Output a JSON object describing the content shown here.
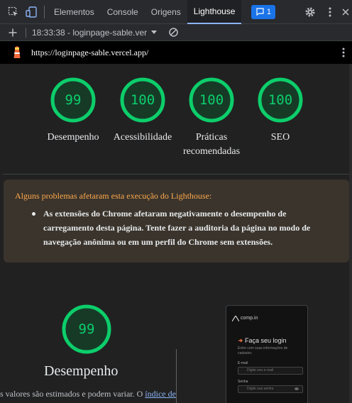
{
  "devtools": {
    "tabs": [
      "Elementos",
      "Console",
      "Origens",
      "Lighthouse"
    ],
    "active_tab": "Lighthouse",
    "issues_count": "1",
    "toolbar": {
      "report_select": "18:33:38 - loginpage-sable.ver"
    }
  },
  "url_bar": {
    "url": "https://loginpage-sable.vercel.app/"
  },
  "summary": {
    "scores": [
      {
        "value": "99",
        "label": "Desempenho"
      },
      {
        "value": "100",
        "label": "Acessibilidade"
      },
      {
        "value": "100",
        "label": "Práticas recomendadas"
      },
      {
        "value": "100",
        "label": "SEO"
      }
    ]
  },
  "warning": {
    "title": "Alguns problemas afetaram esta execução do Lighthouse:",
    "item": "As extensões do Chrome afetaram negativamente o desempenho de carregamento desta página. Tente fazer a auditoria da página no modo de navegação anônima ou em um perfil do Chrome sem extensões."
  },
  "performance": {
    "score": "99",
    "title": "Desempenho",
    "footnote_text": "s valores são estimados e podem variar. O ",
    "footnote_link": "índice de"
  },
  "screenshot_preview": {
    "logo": "comp.in",
    "title": "Faça seu login",
    "subtitle": "Entre com suas informações de cadastro.",
    "email_label": "E-mail",
    "email_placeholder": "Digite seu e-mail",
    "password_label": "Senha",
    "password_placeholder": "Digite sua senha"
  },
  "colors": {
    "score_pass": "#0cce6b",
    "warning_title": "#ffa94d",
    "accent": "#8ab4f8"
  }
}
